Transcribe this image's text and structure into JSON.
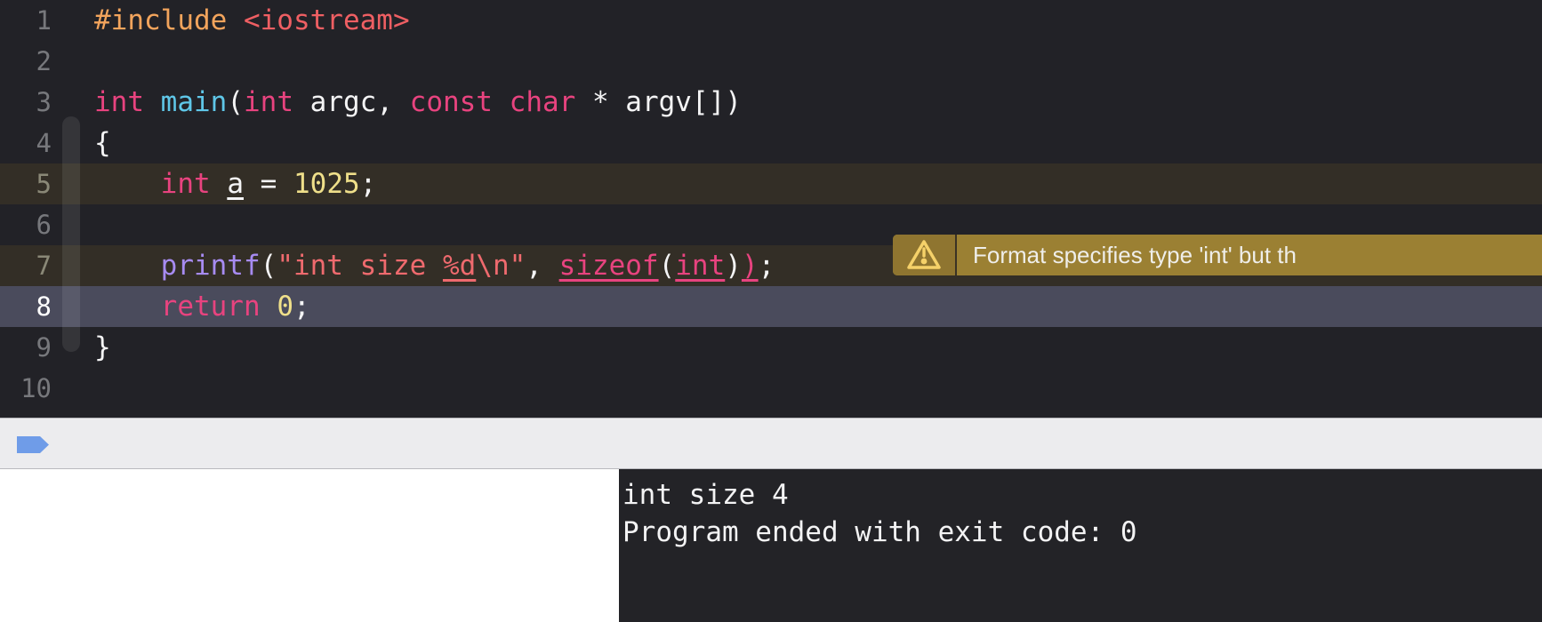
{
  "editor": {
    "language": "cpp",
    "background": "#222227",
    "lines": [
      {
        "num": "1",
        "state": "normal",
        "tokens": [
          {
            "text": "#include",
            "cls": "t-pre"
          },
          {
            "text": " ",
            "cls": "t-plain"
          },
          {
            "text": "<iostream>",
            "cls": "t-hdr"
          }
        ]
      },
      {
        "num": "2",
        "state": "normal",
        "tokens": []
      },
      {
        "num": "3",
        "state": "normal",
        "tokens": [
          {
            "text": "int",
            "cls": "t-kw"
          },
          {
            "text": " ",
            "cls": "t-plain"
          },
          {
            "text": "main",
            "cls": "t-fn"
          },
          {
            "text": "(",
            "cls": "t-plain"
          },
          {
            "text": "int",
            "cls": "t-kw"
          },
          {
            "text": " argc, ",
            "cls": "t-plain"
          },
          {
            "text": "const",
            "cls": "t-kw"
          },
          {
            "text": " ",
            "cls": "t-plain"
          },
          {
            "text": "char",
            "cls": "t-kw"
          },
          {
            "text": " * argv[])",
            "cls": "t-plain"
          }
        ]
      },
      {
        "num": "4",
        "state": "normal",
        "tokens": [
          {
            "text": "{",
            "cls": "t-plain"
          }
        ]
      },
      {
        "num": "5",
        "state": "warning-highlight",
        "tokens": [
          {
            "text": "    ",
            "cls": "t-plain"
          },
          {
            "text": "int",
            "cls": "t-kw"
          },
          {
            "text": " ",
            "cls": "t-plain"
          },
          {
            "text": "a",
            "cls": "t-plain u-line"
          },
          {
            "text": " = ",
            "cls": "t-plain"
          },
          {
            "text": "1025",
            "cls": "t-num"
          },
          {
            "text": ";",
            "cls": "t-plain"
          }
        ]
      },
      {
        "num": "6",
        "state": "normal",
        "tokens": []
      },
      {
        "num": "7",
        "state": "warning-highlight",
        "tokens": [
          {
            "text": "    ",
            "cls": "t-plain"
          },
          {
            "text": "printf",
            "cls": "t-call"
          },
          {
            "text": "(",
            "cls": "t-plain"
          },
          {
            "text": "\"int size ",
            "cls": "t-str"
          },
          {
            "text": "%d",
            "cls": "t-str u-line"
          },
          {
            "text": "\\n\"",
            "cls": "t-str"
          },
          {
            "text": ", ",
            "cls": "t-plain"
          },
          {
            "text": "sizeof",
            "cls": "t-macro u-line"
          },
          {
            "text": "(",
            "cls": "t-plain"
          },
          {
            "text": "int",
            "cls": "t-kw u-line"
          },
          {
            "text": ")",
            "cls": "t-plain"
          },
          {
            "text": ")",
            "cls": "t-macro u-line"
          },
          {
            "text": ";",
            "cls": "t-plain"
          }
        ]
      },
      {
        "num": "8",
        "state": "cursor-line",
        "tokens": [
          {
            "text": "    ",
            "cls": "t-plain"
          },
          {
            "text": "return",
            "cls": "t-kw"
          },
          {
            "text": " ",
            "cls": "t-plain"
          },
          {
            "text": "0",
            "cls": "t-num"
          },
          {
            "text": ";",
            "cls": "t-plain"
          }
        ]
      },
      {
        "num": "9",
        "state": "normal",
        "tokens": [
          {
            "text": "}",
            "cls": "t-plain"
          }
        ]
      },
      {
        "num": "10",
        "state": "normal",
        "tokens": []
      }
    ]
  },
  "warning": {
    "icon": "warning-triangle-icon",
    "message": "Format specifies type 'int' but th",
    "background": "#9b8033",
    "text_color": "#efeeea",
    "severity": "warning"
  },
  "debug_bar": {
    "background": "#ececee",
    "flag_icon": "blue-flag-icon",
    "flag_color": "#6f9ce8"
  },
  "console": {
    "background": "#232327",
    "lines": [
      "int size 4",
      "Program ended with exit code: 0"
    ]
  },
  "variables_pane": {
    "background": "#ffffff",
    "content": ""
  }
}
